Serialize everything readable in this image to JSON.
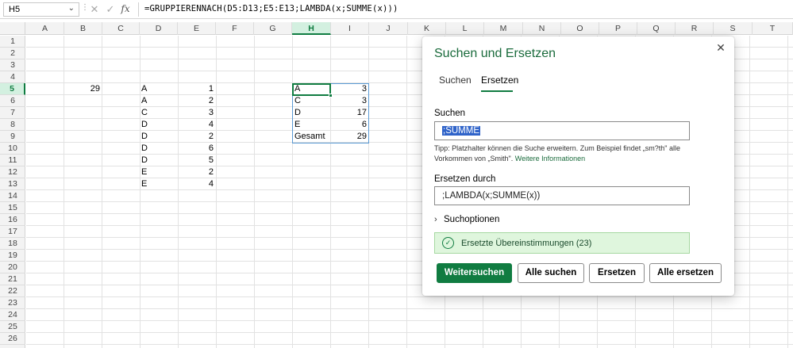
{
  "formula_bar": {
    "name_box": "H5",
    "formula": "=GRUPPIERENNACH(D5:D13;E5:E13;LAMBDA(x;SUMME(x)))",
    "cancel_glyph": "✕",
    "enter_glyph": "✓",
    "fx_glyph": "fx"
  },
  "grid": {
    "columns": [
      "A",
      "B",
      "C",
      "D",
      "E",
      "F",
      "G",
      "H",
      "I",
      "J",
      "K",
      "L",
      "M",
      "N",
      "O",
      "P",
      "Q",
      "R",
      "S",
      "T"
    ],
    "rows": [
      "1",
      "2",
      "3",
      "4",
      "5",
      "6",
      "7",
      "8",
      "9",
      "10",
      "11",
      "12",
      "13",
      "14",
      "15",
      "16",
      "17",
      "18",
      "19",
      "20",
      "21",
      "22",
      "23",
      "24",
      "25",
      "26"
    ],
    "active_column": "H",
    "active_row": "5",
    "cells": {
      "B5": "29",
      "D": [
        "A",
        "A",
        "C",
        "D",
        "D",
        "D",
        "D",
        "E",
        "E"
      ],
      "E": [
        "1",
        "2",
        "3",
        "4",
        "2",
        "6",
        "5",
        "2",
        "4"
      ],
      "H": [
        "A",
        "C",
        "D",
        "E",
        "Gesamt"
      ],
      "I": [
        "3",
        "3",
        "17",
        "6",
        "29"
      ]
    }
  },
  "dialog": {
    "title": "Suchen und Ersetzen",
    "close_glyph": "✕",
    "tabs": [
      "Suchen",
      "Ersetzen"
    ],
    "active_tab": "Ersetzen",
    "find_label": "Suchen",
    "find_value": ";SUMME",
    "tip_text": "Tipp: Platzhalter können die Suche erweitern. Zum Beispiel findet „sm?th\" alle Vorkommen von „Smith\".",
    "tip_link": "Weitere Informationen",
    "replace_label": "Ersetzen durch",
    "replace_value": ";LAMBDA(x;SUMME(x))",
    "options_label": "Suchoptionen",
    "status_text": "Ersetzte Übereinstimmungen (23)",
    "buttons": {
      "find_next": "Weitersuchen",
      "find_all": "Alle suchen",
      "replace": "Ersetzen",
      "replace_all": "Alle ersetzen"
    }
  },
  "colors": {
    "accent": "#107c41",
    "status_bg": "#dff6dd",
    "selection": "#2f63c9"
  }
}
